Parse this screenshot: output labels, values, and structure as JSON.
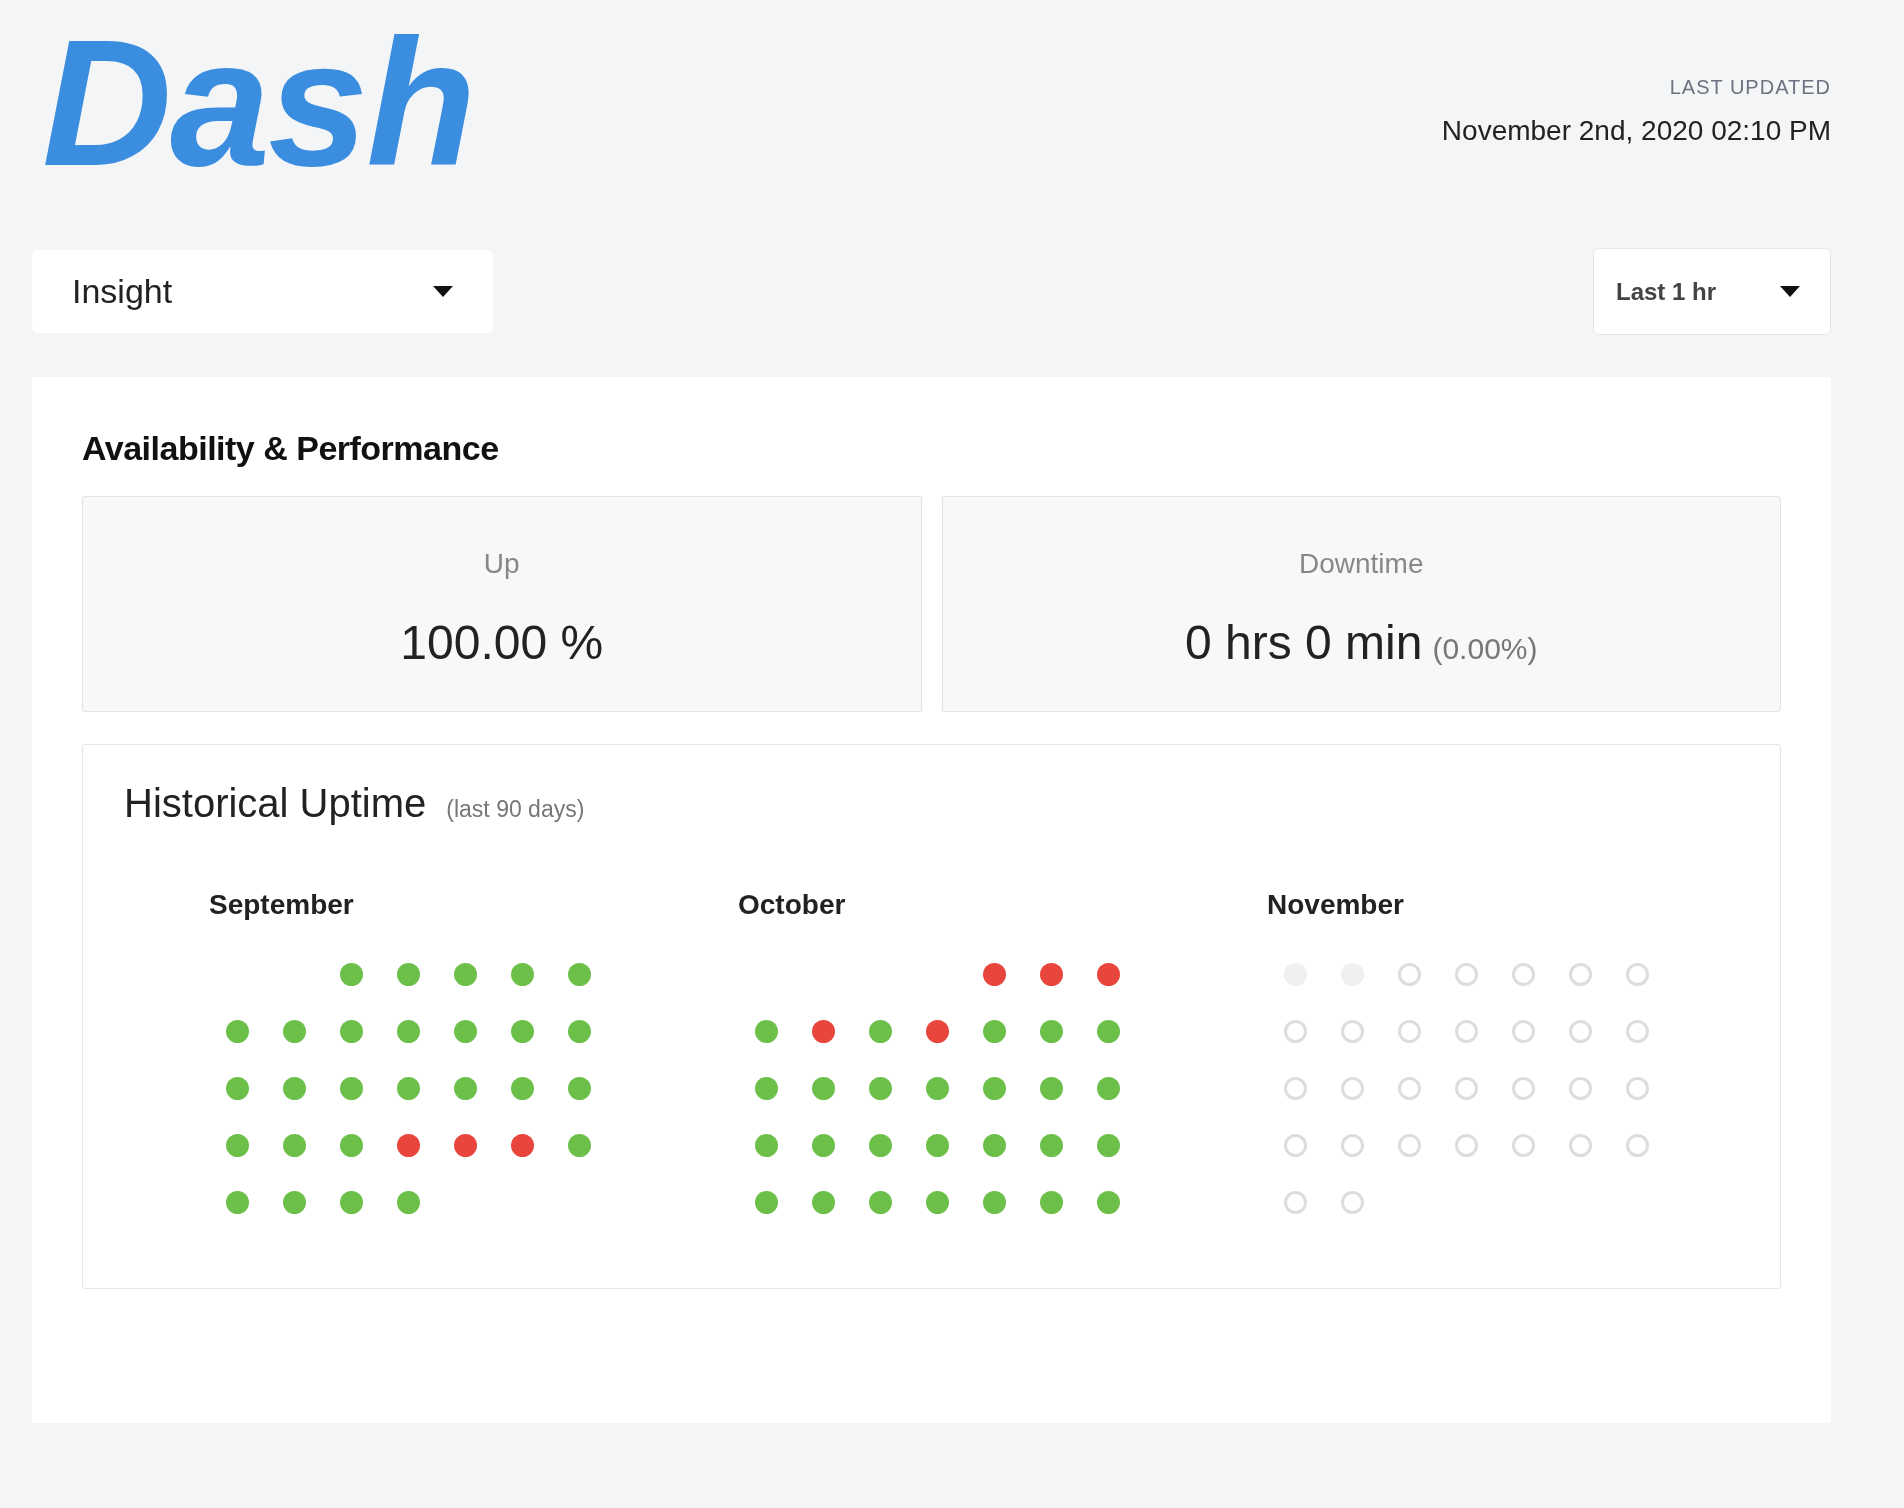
{
  "logo": {
    "text": "Dash"
  },
  "last_updated": {
    "label": "LAST UPDATED",
    "value": "November 2nd, 2020 02:10 PM"
  },
  "service_dropdown": {
    "value": "Insight"
  },
  "range_dropdown": {
    "value": "Last 1 hr"
  },
  "section_title": "Availability & Performance",
  "stats": [
    {
      "label": "Up",
      "value": "100.00 %"
    },
    {
      "label": "Downtime",
      "value": "0 hrs 0 min",
      "note": "(0.00%)"
    }
  ],
  "historical": {
    "title": "Historical Uptime",
    "subtitle": "(last 90 days)",
    "months": [
      {
        "name": "September",
        "days": [
          {
            "kind": "blank"
          },
          {
            "kind": "blank"
          },
          {
            "kind": "up"
          },
          {
            "kind": "up"
          },
          {
            "kind": "up"
          },
          {
            "kind": "up"
          },
          {
            "kind": "up"
          },
          {
            "kind": "up"
          },
          {
            "kind": "up"
          },
          {
            "kind": "up"
          },
          {
            "kind": "up"
          },
          {
            "kind": "up"
          },
          {
            "kind": "up"
          },
          {
            "kind": "up"
          },
          {
            "kind": "up"
          },
          {
            "kind": "up"
          },
          {
            "kind": "up"
          },
          {
            "kind": "up"
          },
          {
            "kind": "up"
          },
          {
            "kind": "up"
          },
          {
            "kind": "up"
          },
          {
            "kind": "up"
          },
          {
            "kind": "up"
          },
          {
            "kind": "up"
          },
          {
            "kind": "down"
          },
          {
            "kind": "down"
          },
          {
            "kind": "down"
          },
          {
            "kind": "up"
          },
          {
            "kind": "up"
          },
          {
            "kind": "up"
          },
          {
            "kind": "up"
          },
          {
            "kind": "up"
          }
        ]
      },
      {
        "name": "October",
        "days": [
          {
            "kind": "blank"
          },
          {
            "kind": "blank"
          },
          {
            "kind": "blank"
          },
          {
            "kind": "blank"
          },
          {
            "kind": "down"
          },
          {
            "kind": "down"
          },
          {
            "kind": "down"
          },
          {
            "kind": "up"
          },
          {
            "kind": "down"
          },
          {
            "kind": "up"
          },
          {
            "kind": "down"
          },
          {
            "kind": "up"
          },
          {
            "kind": "up"
          },
          {
            "kind": "up"
          },
          {
            "kind": "up"
          },
          {
            "kind": "up"
          },
          {
            "kind": "up"
          },
          {
            "kind": "up"
          },
          {
            "kind": "up"
          },
          {
            "kind": "up"
          },
          {
            "kind": "up"
          },
          {
            "kind": "up"
          },
          {
            "kind": "up"
          },
          {
            "kind": "up"
          },
          {
            "kind": "up"
          },
          {
            "kind": "up"
          },
          {
            "kind": "up"
          },
          {
            "kind": "up"
          },
          {
            "kind": "up"
          },
          {
            "kind": "up"
          },
          {
            "kind": "up"
          },
          {
            "kind": "up"
          },
          {
            "kind": "up"
          },
          {
            "kind": "up"
          },
          {
            "kind": "up"
          }
        ]
      },
      {
        "name": "November",
        "days": [
          {
            "kind": "nodata"
          },
          {
            "kind": "nodata"
          },
          {
            "kind": "future"
          },
          {
            "kind": "future"
          },
          {
            "kind": "future"
          },
          {
            "kind": "future"
          },
          {
            "kind": "future"
          },
          {
            "kind": "future"
          },
          {
            "kind": "future"
          },
          {
            "kind": "future"
          },
          {
            "kind": "future"
          },
          {
            "kind": "future"
          },
          {
            "kind": "future"
          },
          {
            "kind": "future"
          },
          {
            "kind": "future"
          },
          {
            "kind": "future"
          },
          {
            "kind": "future"
          },
          {
            "kind": "future"
          },
          {
            "kind": "future"
          },
          {
            "kind": "future"
          },
          {
            "kind": "future"
          },
          {
            "kind": "future"
          },
          {
            "kind": "future"
          },
          {
            "kind": "future"
          },
          {
            "kind": "future"
          },
          {
            "kind": "future"
          },
          {
            "kind": "future"
          },
          {
            "kind": "future"
          },
          {
            "kind": "future"
          },
          {
            "kind": "future"
          }
        ]
      }
    ]
  }
}
